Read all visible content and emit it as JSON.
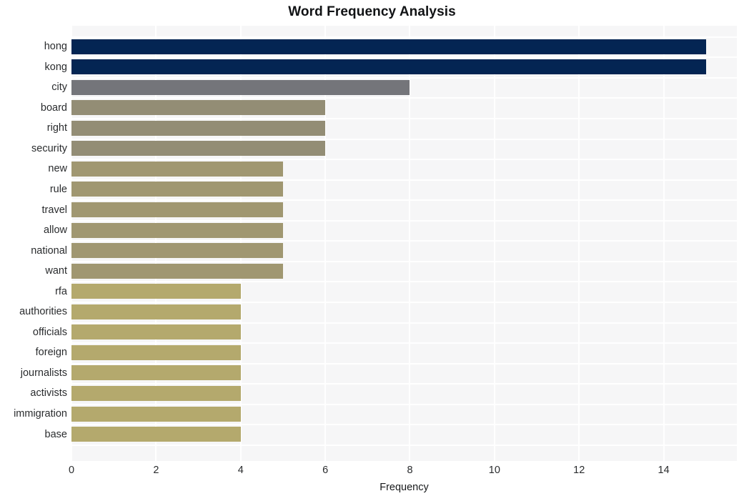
{
  "chart_data": {
    "type": "bar",
    "orientation": "horizontal",
    "title": "Word Frequency Analysis",
    "xlabel": "Frequency",
    "ylabel": "",
    "categories": [
      "hong",
      "kong",
      "city",
      "board",
      "right",
      "security",
      "new",
      "rule",
      "travel",
      "allow",
      "national",
      "want",
      "rfa",
      "authorities",
      "officials",
      "foreign",
      "journalists",
      "activists",
      "immigration",
      "base"
    ],
    "values": [
      15,
      15,
      8,
      6,
      6,
      6,
      5,
      5,
      5,
      5,
      5,
      5,
      4,
      4,
      4,
      4,
      4,
      4,
      4,
      4
    ],
    "bar_colors": [
      "#042553",
      "#042553",
      "#74757a",
      "#938d75",
      "#938d75",
      "#938d75",
      "#a09771",
      "#a09771",
      "#a09771",
      "#a09771",
      "#a09771",
      "#a09771",
      "#b4a96d",
      "#b4a96d",
      "#b4a96d",
      "#b4a96d",
      "#b4a96d",
      "#b4a96d",
      "#b4a96d",
      "#b4a96d"
    ],
    "xlim": [
      0,
      15.73
    ],
    "xticks": [
      0,
      2,
      4,
      6,
      8,
      10,
      12,
      14
    ],
    "xtick_labels": [
      "0",
      "2",
      "4",
      "6",
      "8",
      "10",
      "12",
      "14"
    ],
    "grid": true,
    "legend": null,
    "plot_background": "#f6f6f7",
    "figure_background": "#ffffff",
    "gridline_color": "#ffffff"
  }
}
